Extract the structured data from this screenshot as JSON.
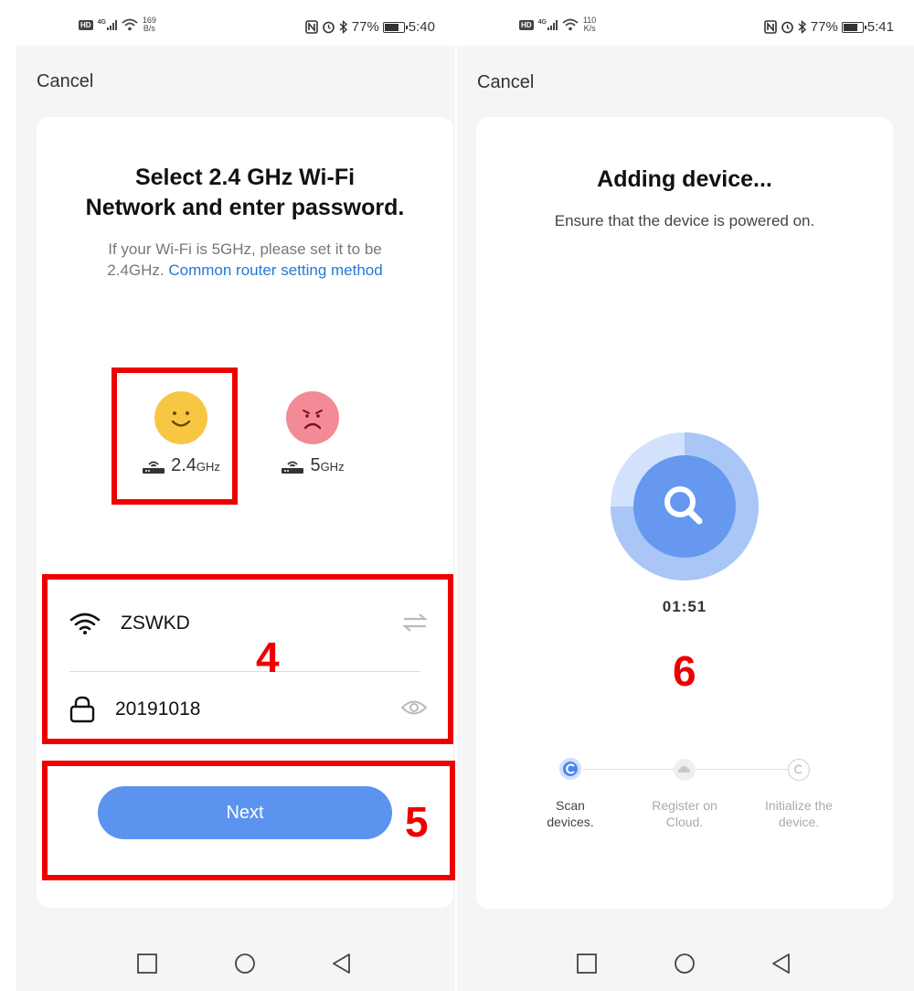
{
  "left": {
    "status": {
      "net_type": "4G",
      "speed_value": "169",
      "speed_unit": "B/s",
      "battery": "77%",
      "time": "5:40"
    },
    "cancel_label": "Cancel",
    "title_line1": "Select 2.4 GHz Wi-Fi",
    "title_line2": "Network and enter password.",
    "subtitle_line1": "If your Wi-Fi is 5GHz, please set it to be",
    "subtitle_line2_prefix": "2.4GHz. ",
    "router_link": "Common router setting method",
    "freq_24_value": "2.4",
    "freq_5_value": "5",
    "freq_unit": "GHz",
    "wifi_ssid": "ZSWKD",
    "wifi_password": "20191018",
    "next_label": "Next",
    "step4": "4",
    "step5": "5"
  },
  "right": {
    "status": {
      "net_type": "4G",
      "speed_value": "110",
      "speed_unit": "K/s",
      "battery": "77%",
      "time": "5:41"
    },
    "cancel_label": "Cancel",
    "title": "Adding device...",
    "subtitle": "Ensure that the device is powered on.",
    "timer": "01:51",
    "scan_progress": 0.75,
    "step6": "6",
    "steps": [
      {
        "line1": "Scan",
        "line2": "devices."
      },
      {
        "line1": "Register on",
        "line2": "Cloud."
      },
      {
        "line1": "Initialize the",
        "line2": "device."
      }
    ]
  },
  "colors": {
    "accent": "#5b93ef",
    "link": "#1f7ad8",
    "highlight": "#ee0000",
    "happy_face": "#f7c744",
    "sad_face": "#f28b95"
  },
  "icons": [
    "hd-icon",
    "signal-icon",
    "wifi-icon",
    "nfc-icon",
    "alarm-icon",
    "bluetooth-icon",
    "battery-icon",
    "router-icon",
    "swap-icon",
    "lock-icon",
    "eye-icon",
    "search-icon",
    "cloud-icon",
    "copyright-icon",
    "square-icon",
    "circle-icon",
    "back-triangle-icon"
  ]
}
